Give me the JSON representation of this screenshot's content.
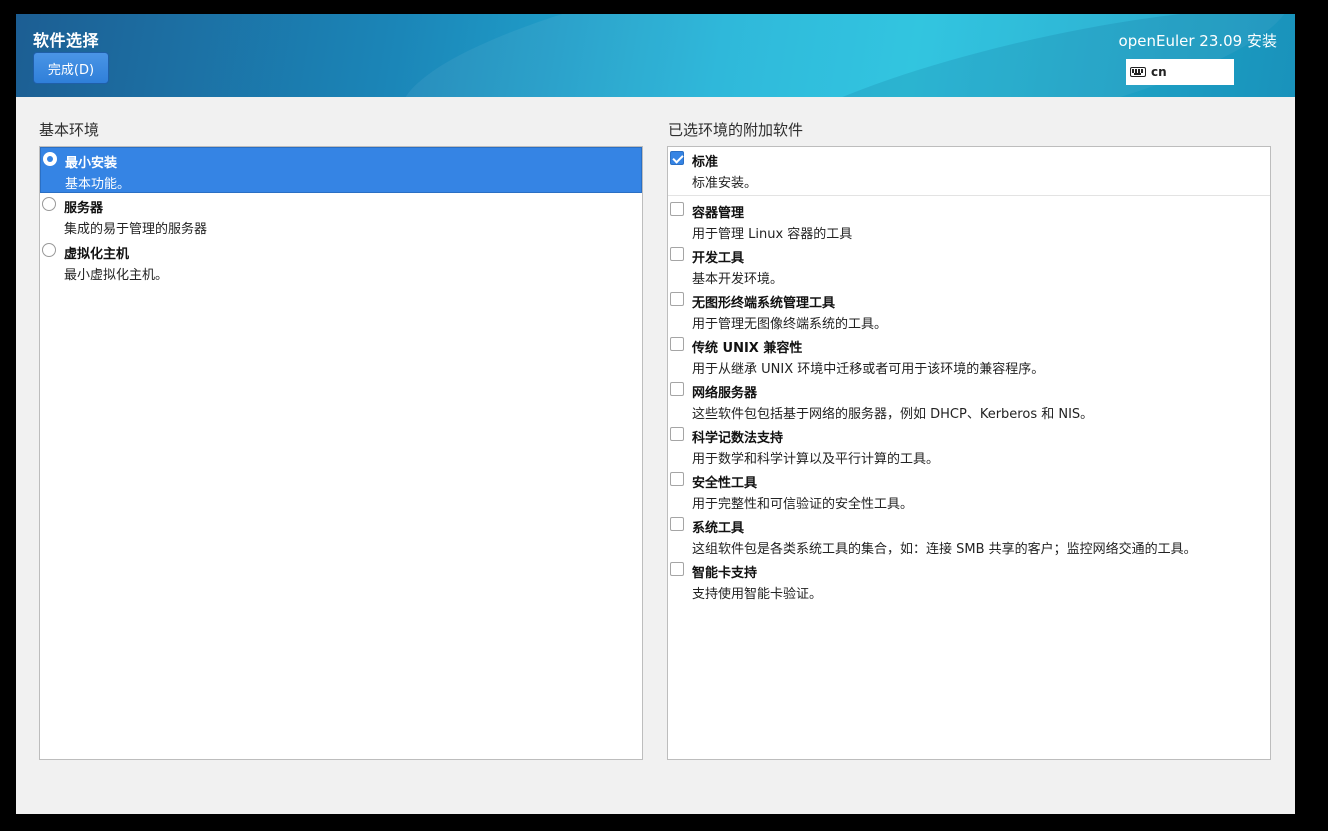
{
  "header": {
    "page_title": "软件选择",
    "done_button": "完成(D)",
    "product_title": "openEuler 23.09 安装",
    "keyboard_layout": "cn"
  },
  "environment": {
    "label": "基本环境",
    "items": [
      {
        "name": "最小安装",
        "description": "基本功能。",
        "selected": true
      },
      {
        "name": "服务器",
        "description": "集成的易于管理的服务器",
        "selected": false
      },
      {
        "name": "虚拟化主机",
        "description": "最小虚拟化主机。",
        "selected": false
      }
    ]
  },
  "addons": {
    "label": "已选环境的附加软件",
    "items": [
      {
        "name": "标准",
        "description": "标准安装。",
        "checked": true
      },
      {
        "name": "容器管理",
        "description": "用于管理 Linux 容器的工具",
        "checked": false
      },
      {
        "name": "开发工具",
        "description": "基本开发环境。",
        "checked": false
      },
      {
        "name": "无图形终端系统管理工具",
        "description": "用于管理无图像终端系统的工具。",
        "checked": false
      },
      {
        "name": "传统 UNIX 兼容性",
        "description": "用于从继承 UNIX 环境中迁移或者可用于该环境的兼容程序。",
        "checked": false
      },
      {
        "name": "网络服务器",
        "description": "这些软件包包括基于网络的服务器，例如 DHCP、Kerberos 和 NIS。",
        "checked": false
      },
      {
        "name": "科学记数法支持",
        "description": "用于数学和科学计算以及平行计算的工具。",
        "checked": false
      },
      {
        "name": "安全性工具",
        "description": "用于完整性和可信验证的安全性工具。",
        "checked": false
      },
      {
        "name": "系统工具",
        "description": "这组软件包是各类系统工具的集合，如：连接 SMB 共享的客户；监控网络交通的工具。",
        "checked": false
      },
      {
        "name": "智能卡支持",
        "description": "支持使用智能卡验证。",
        "checked": false
      }
    ]
  },
  "colors": {
    "accent": "#3584e4",
    "header_start": "#1c5e93",
    "header_end": "#26c2de"
  }
}
